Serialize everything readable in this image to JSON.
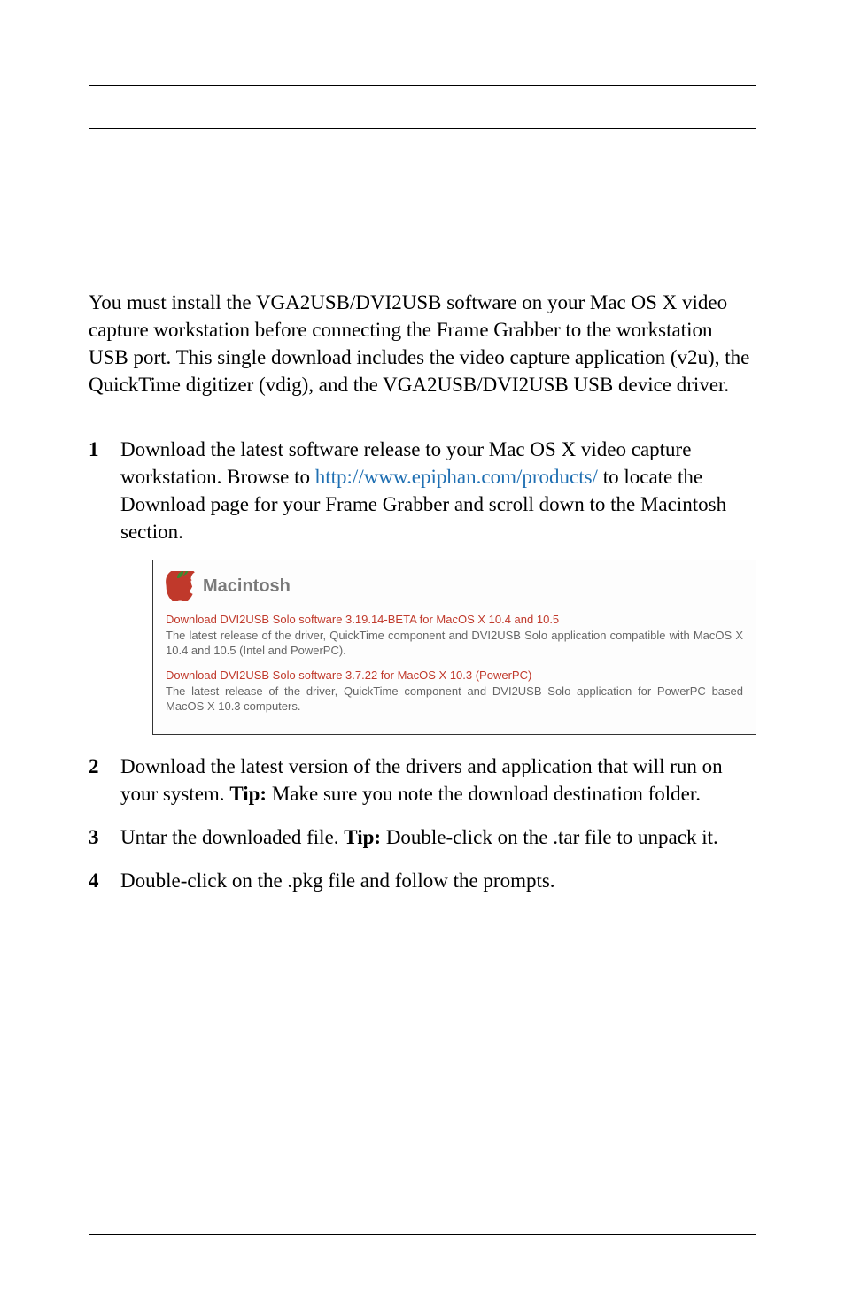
{
  "intro": "You must install the VGA2USB/DVI2USB software on your Mac OS X video capture workstation before connecting the Frame Grabber to the workstation USB port. This single download includes the video capture application (v2u), the QuickTime digitizer (vdig), and the VGA2USB/DVI2USB USB device driver.",
  "steps": {
    "s1_a": "Download the latest software release to your Mac OS X video capture workstation. Browse to ",
    "s1_link": "http://www.epiphan.com/products/",
    "s1_b": " to locate the Download page for your Frame Grabber and scroll down to the Macintosh section.",
    "s2_a": "Download the latest version of the drivers and application that will run on your system. ",
    "s2_tip_label": "Tip:",
    "s2_tip": " Make sure you note the download destination folder.",
    "s3_a": "Untar the downloaded file. ",
    "s3_tip_label": "Tip:",
    "s3_tip": " Double-click on the .tar file to unpack it.",
    "s4": "Double-click on the .pkg file and follow the prompts."
  },
  "macbox": {
    "title": "Macintosh",
    "block1_link": "Download DVI2USB Solo software 3.19.14-BETA for MacOS X 10.4 and 10.5",
    "block1_text": "The latest release of the driver, QuickTime component and DVI2USB Solo application compatible with MacOS X 10.4 and 10.5 (Intel and PowerPC).",
    "block2_link": "Download DVI2USB Solo software 3.7.22 for MacOS X 10.3 (PowerPC)",
    "block2_text": "The latest release of the driver, QuickTime component and DVI2USB Solo application for PowerPC based MacOS X 10.3 computers."
  }
}
